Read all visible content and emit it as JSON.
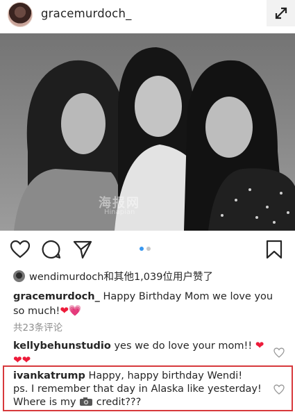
{
  "post": {
    "username": "gracemurdoch_",
    "watermark": "海报网",
    "watermark_sub": "Hinapian"
  },
  "likes": {
    "text": "wendimurdoch和其他1,039位用户赞了"
  },
  "comments": [
    {
      "user": "gracemurdoch_",
      "text": " Happy Birthday Mom we love you so much!",
      "emoji": [
        "red-heart",
        "pink-heart"
      ]
    },
    {
      "user": "kellybehunstudio",
      "text": " yes we do love your mom!! ",
      "emoji": [
        "red-heart",
        "red-heart",
        "red-heart"
      ]
    },
    {
      "user": "ivankatrump",
      "line1": " Happy, happy birthday Wendi!",
      "line2": "ps. I remember that day in Alaska like yesterday!",
      "line3a": "Where is my ",
      "line3b": " credit???"
    }
  ],
  "comments_count": "共23条评论",
  "carousel": {
    "pages": 2,
    "active": 1
  },
  "colors": {
    "highlight": "#d7383b",
    "heart": "#ed1b3a",
    "dot_active": "#3897f0"
  },
  "icons": [
    "expand-icon",
    "heart-icon",
    "comment-icon",
    "share-icon",
    "bookmark-icon",
    "camera-icon"
  ]
}
